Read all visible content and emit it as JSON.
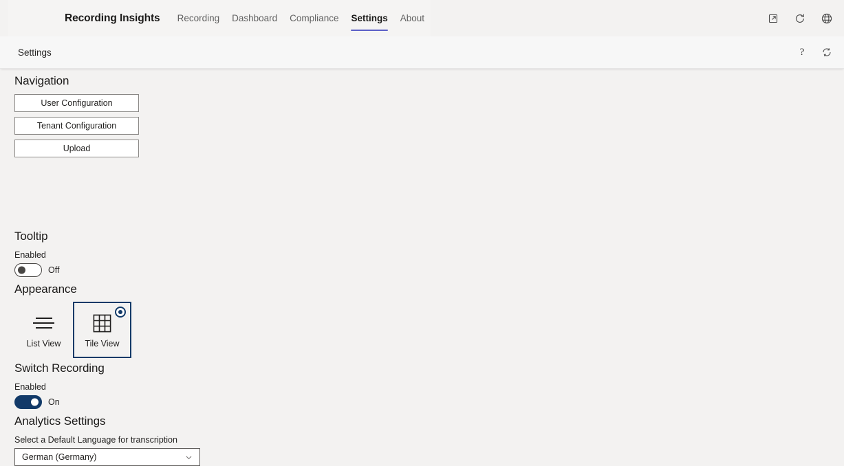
{
  "app_bar": {
    "brand_title": "Recording Insights",
    "tabs": [
      {
        "label": "Recording",
        "active": false
      },
      {
        "label": "Dashboard",
        "active": false
      },
      {
        "label": "Compliance",
        "active": false
      },
      {
        "label": "Settings",
        "active": true
      },
      {
        "label": "About",
        "active": false
      }
    ],
    "icons": [
      {
        "name": "pop-out-icon"
      },
      {
        "name": "refresh-icon"
      },
      {
        "name": "globe-icon"
      }
    ],
    "accent_color": "#5b5fc7"
  },
  "sub_header": {
    "title": "Settings",
    "help_label": "?",
    "icons": [
      {
        "name": "help-icon"
      },
      {
        "name": "sync-icon"
      }
    ]
  },
  "navigation": {
    "heading": "Navigation",
    "buttons": [
      {
        "label": "User Configuration"
      },
      {
        "label": "Tenant Configuration"
      },
      {
        "label": "Upload"
      }
    ]
  },
  "tooltip": {
    "heading": "Tooltip",
    "label": "Enabled",
    "state_text": "Off",
    "enabled": false
  },
  "appearance": {
    "heading": "Appearance",
    "options": [
      {
        "label": "List View",
        "icon": "list-view-icon",
        "selected": false
      },
      {
        "label": "Tile View",
        "icon": "tile-view-icon",
        "selected": true
      }
    ],
    "selected_color": "#123a68"
  },
  "switch_recording": {
    "heading": "Switch Recording",
    "label": "Enabled",
    "state_text": "On",
    "enabled": true,
    "on_color": "#123a68"
  },
  "analytics": {
    "heading": "Analytics Settings",
    "label": "Select a Default Language for transcription",
    "selected_language": "German (Germany)"
  }
}
